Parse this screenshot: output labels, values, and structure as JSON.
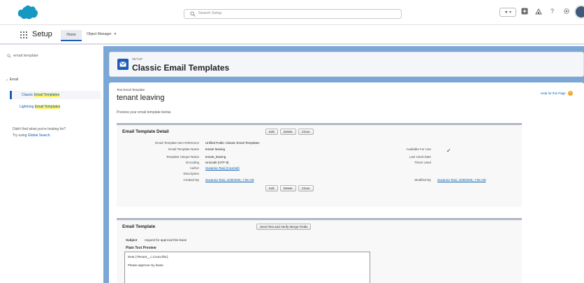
{
  "header": {
    "search_placeholder": "Search Setup",
    "fav_label": "★ ▾"
  },
  "nav": {
    "app_name": "Setup",
    "tabs": [
      {
        "label": "Home"
      },
      {
        "label": "Object Manager"
      }
    ],
    "om_chevron": "▾"
  },
  "sidebar": {
    "quick_find_value": "email template",
    "tree_section": "Email",
    "items": [
      {
        "prefix": "Classic ",
        "highlight": "Email Templates"
      },
      {
        "prefix": "Lightning ",
        "highlight": "Email Templates"
      }
    ],
    "help_line_1": "Didn't find what you're looking for?",
    "help_line_2_prefix": "Try using ",
    "help_line_2_link": "Global Search."
  },
  "page_header": {
    "kicker": "SETUP",
    "title": "Classic Email Templates"
  },
  "template": {
    "kicker": "Text Email Template",
    "name": "tenant leaving",
    "description": "Preview your email template below.",
    "help_link": "Help for this Page"
  },
  "detail": {
    "title": "Email Template Detail",
    "buttons": [
      "Edit",
      "Delete",
      "Clone"
    ],
    "left_fields": [
      {
        "label": "Email Template Item Reference",
        "value": "Unfiled Public Classic Email Templates",
        "link": false
      },
      {
        "label": "Email Template Name",
        "value": "tenant leaving",
        "link": false
      },
      {
        "label": "Template Unique Name",
        "value": "tenant_leaving",
        "link": false
      },
      {
        "label": "Encoding",
        "value": "Unicode (UTF-8)",
        "link": false
      },
      {
        "label": "Author",
        "value": "Susanna Tsaii (Counsel)",
        "link": true
      },
      {
        "label": "Description",
        "value": "",
        "link": false
      },
      {
        "label": "Created By",
        "value": "Susanna Tsaii, 4/28/2025, 7:56 AM",
        "link": true
      }
    ],
    "right_fields": [
      {
        "label": "Available For Use",
        "value": ""
      },
      {
        "label": "Last Used Date",
        "value": ""
      },
      {
        "label": "Times Used",
        "value": ""
      }
    ],
    "modified_label": "Modified By",
    "modified_value": "Susanna Tsaii, 4/28/2025, 7:56 AM",
    "check": "✓"
  },
  "email": {
    "title": "Email Template",
    "button": "Send Test and Verify Merge Fields",
    "subject_label": "Subject",
    "subject_value": "request for approval this lease",
    "preview_label": "Plain Text Preview",
    "preview_line_1": "Dear {!Tenant__c.Councillor},",
    "preview_line_2": "Please approve my lease."
  }
}
